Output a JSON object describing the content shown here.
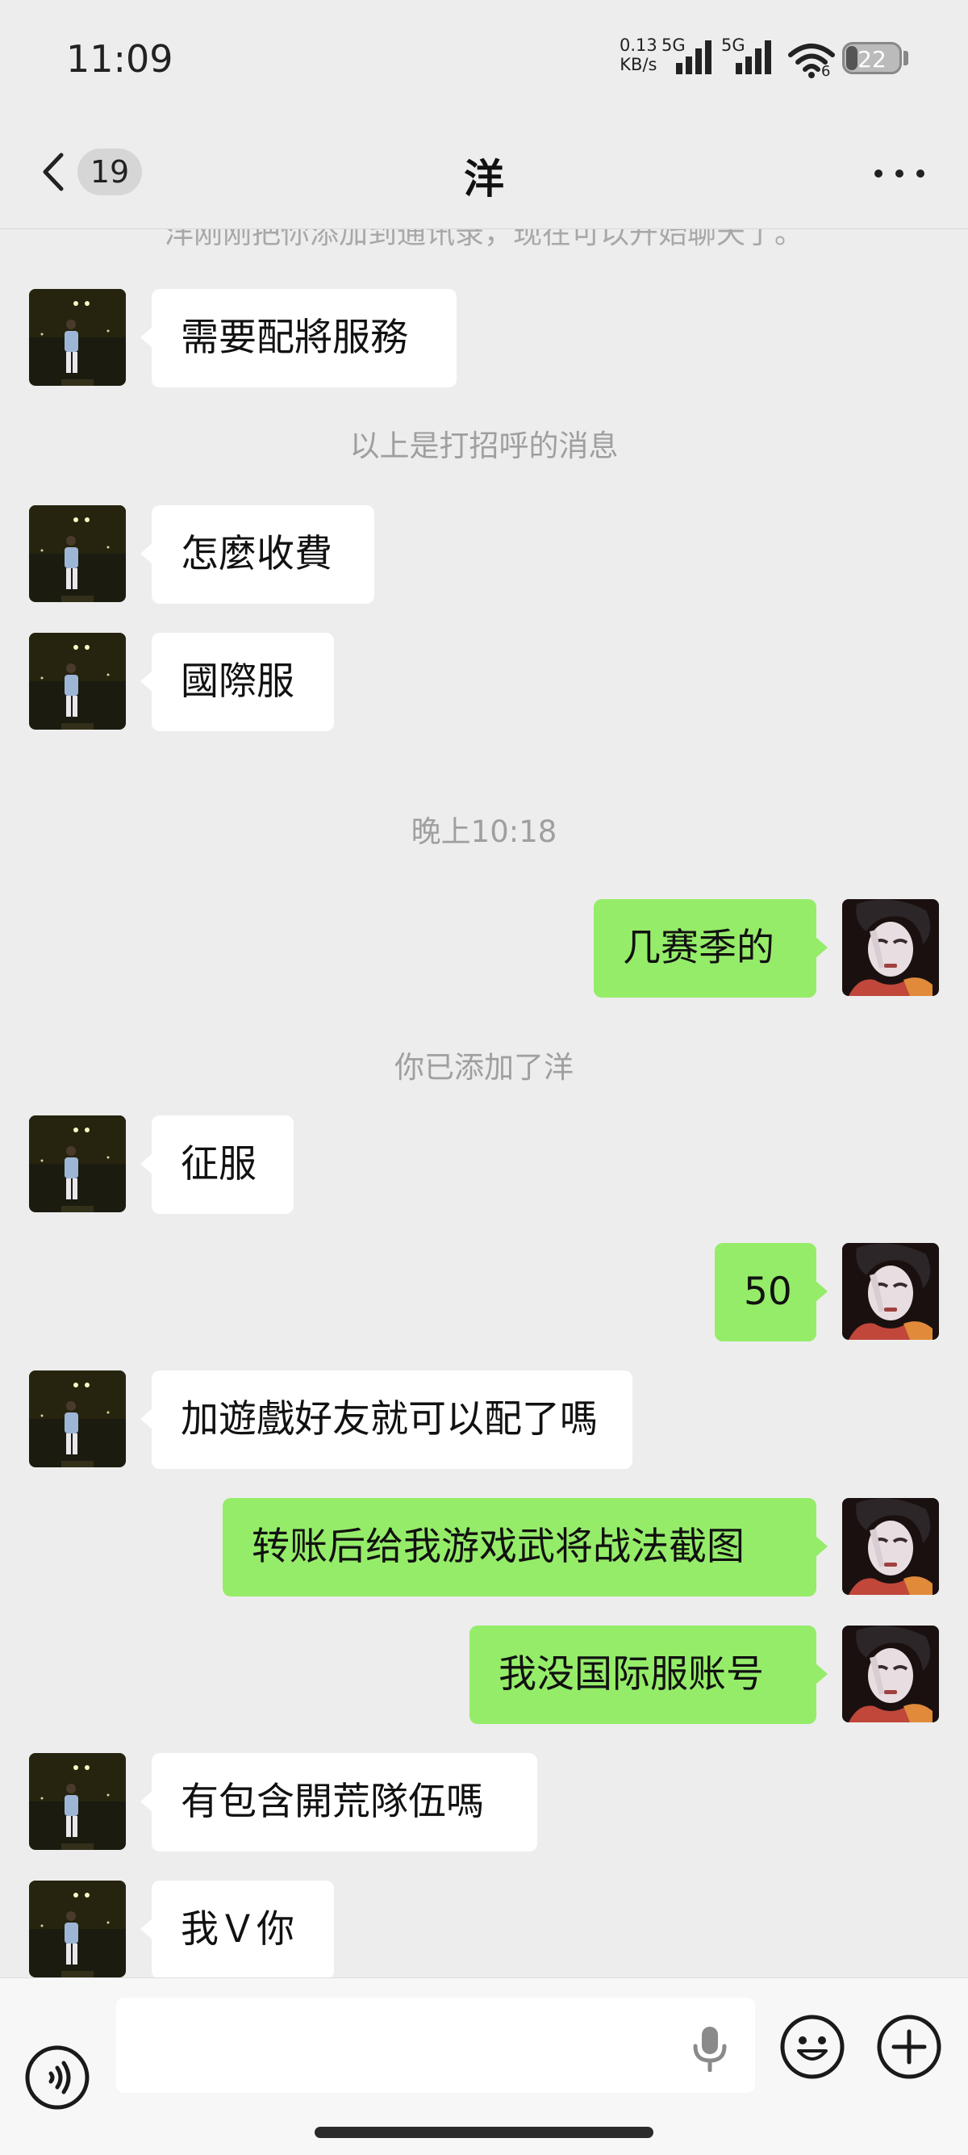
{
  "status_bar": {
    "time": "11:09",
    "net_speed_value": "0.13",
    "net_speed_unit": "KB/s",
    "signal1_label": "5G",
    "signal2_label": "5G",
    "wifi_label": "6",
    "battery": "22",
    "battery_level_pct": 22
  },
  "nav": {
    "unread_count": "19",
    "title": "洋"
  },
  "chat": {
    "clipped_notice": "洋刚刚把你添加到通讯录，现在可以开始聊天了。",
    "messages": [
      {
        "side": "in",
        "text": "需要配將服務"
      },
      {
        "side": "system",
        "text": "以上是打招呼的消息"
      },
      {
        "side": "in",
        "text": "怎麼收費"
      },
      {
        "side": "in",
        "text": "國際服"
      },
      {
        "side": "time",
        "text": "晚上10:18"
      },
      {
        "side": "out",
        "text": "几赛季的"
      },
      {
        "side": "system",
        "text": "你已添加了洋"
      },
      {
        "side": "in",
        "text": "征服"
      },
      {
        "side": "out",
        "text": "50"
      },
      {
        "side": "in",
        "text": "加遊戲好友就可以配了嗎"
      },
      {
        "side": "out",
        "text": "转账后给我游戏武将战法截图"
      },
      {
        "side": "out",
        "text": "我没国际服账号"
      },
      {
        "side": "in",
        "text": "有包含開荒隊伍嗎"
      },
      {
        "side": "in",
        "text": "我Ｖ你"
      }
    ]
  },
  "input_bar": {
    "placeholder": ""
  },
  "colors": {
    "background": "#ededed",
    "outgoing_bubble": "#95ec69",
    "incoming_bubble": "#ffffff",
    "system_text": "#9f9f9f"
  },
  "icons": [
    "back-chevron-icon",
    "more-icon",
    "voice-icon",
    "microphone-icon",
    "emoji-icon",
    "plus-icon",
    "signal-icon",
    "wifi-icon",
    "battery-icon"
  ]
}
